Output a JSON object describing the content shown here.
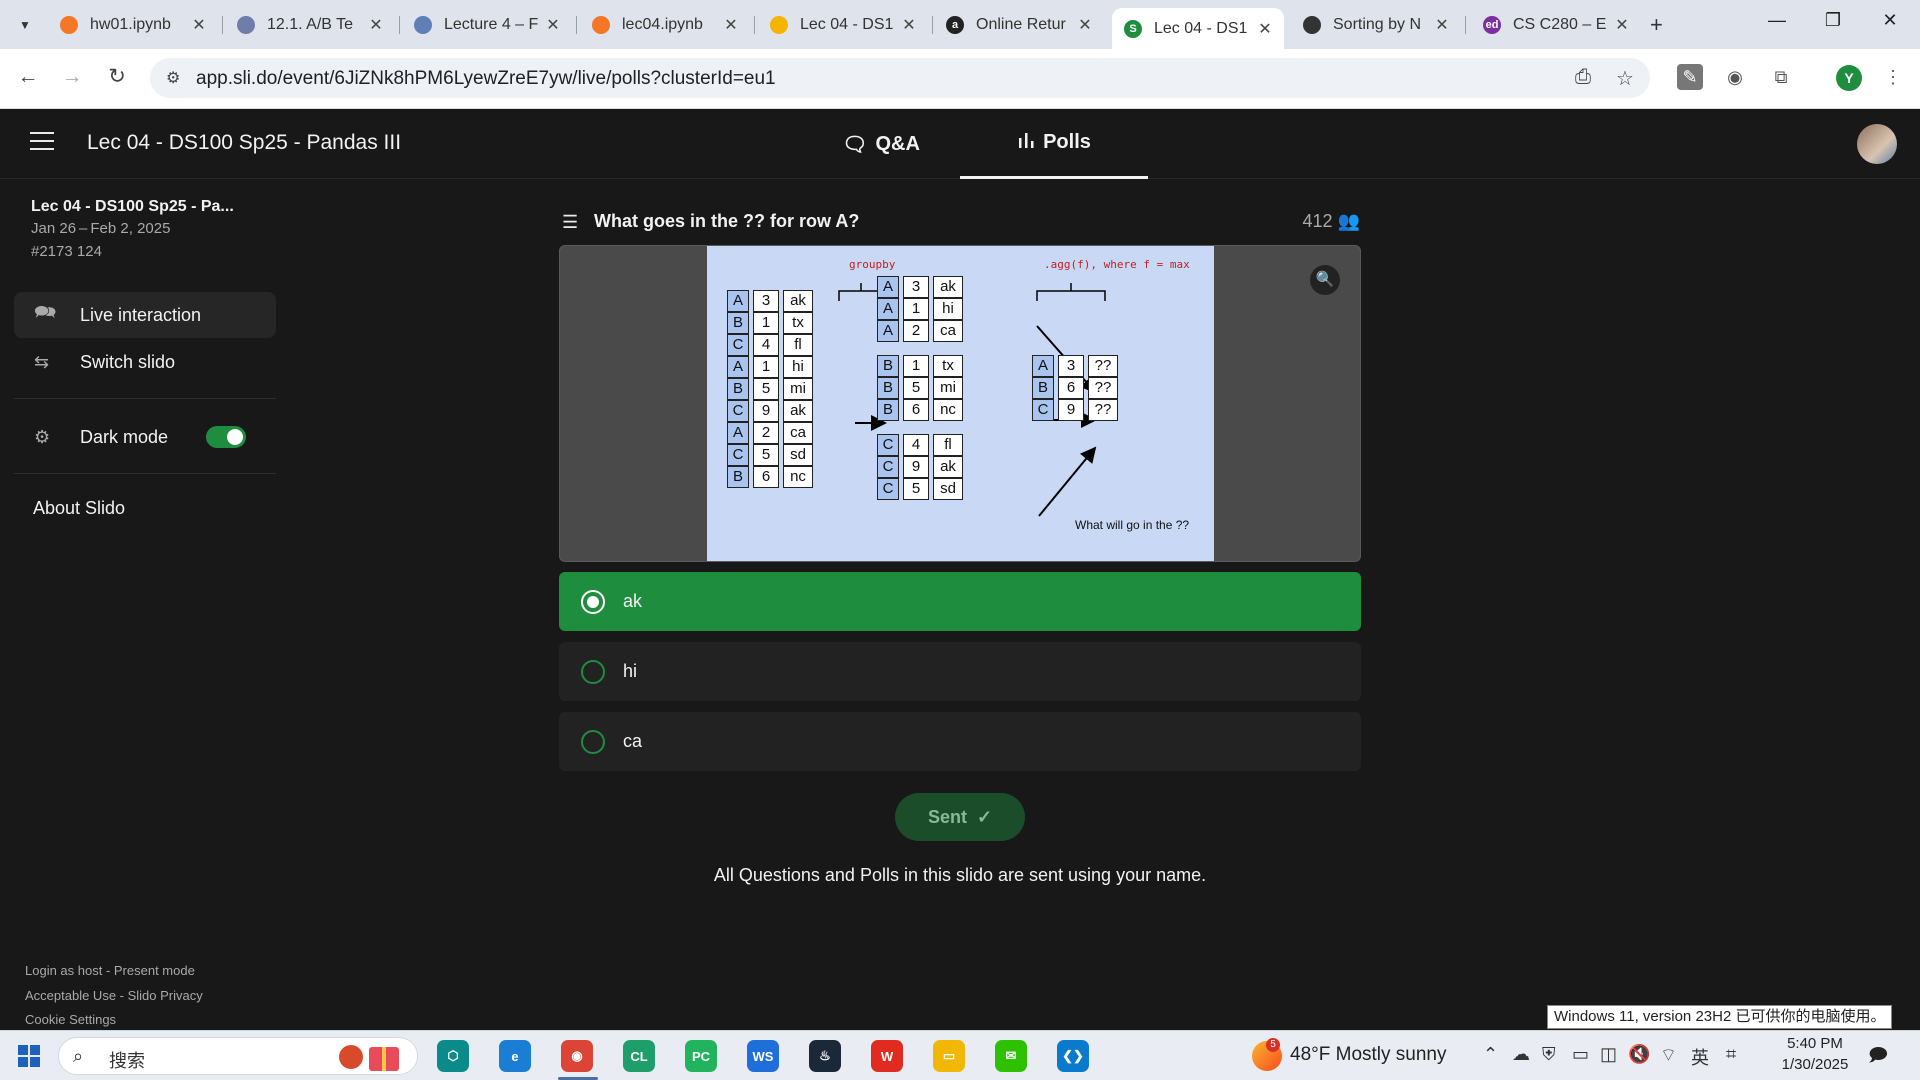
{
  "browser": {
    "tabs": [
      {
        "title": "hw01.ipynb",
        "color": "#f37726",
        "glyph": ""
      },
      {
        "title": "12.1. A/B Te",
        "color": "#6f7dab",
        "glyph": ""
      },
      {
        "title": "Lecture 4 – F",
        "color": "#5f7fb5",
        "glyph": ""
      },
      {
        "title": "lec04.ipynb",
        "color": "#f37726",
        "glyph": ""
      },
      {
        "title": "Lec 04 - DS1",
        "color": "#f4b400",
        "glyph": ""
      },
      {
        "title": "Online Retur",
        "color": "#222222",
        "glyph": "a"
      },
      {
        "title": "Lec 04 - DS1",
        "color": "#1e8e3e",
        "glyph": "S"
      },
      {
        "title": "Sorting by N",
        "color": "#333333",
        "glyph": ""
      },
      {
        "title": "CS C280 – E",
        "color": "#7b2fa0",
        "glyph": "ed"
      }
    ],
    "url": "app.sli.do/event/6JiZNk8hPM6LyewZreE7yw/live/polls?clusterId=eu1",
    "profile_initial": "Y"
  },
  "header": {
    "event_title": "Lec 04 - DS100 Sp25 - Pandas III",
    "tab_qa": "Q&A",
    "tab_polls": "Polls"
  },
  "sidebar": {
    "event_name": "Lec 04 - DS100 Sp25 - Pa...",
    "dates": "Jan 26 – Feb 2, 2025",
    "code": "#2173 124",
    "live_interaction": "Live interaction",
    "switch_slido": "Switch slido",
    "dark_mode": "Dark mode",
    "dark_mode_on": true,
    "about": "About Slido",
    "footer_1": "Login as host - Present mode",
    "footer_2": "Acceptable Use - Slido Privacy",
    "footer_3": "Cookie Settings"
  },
  "poll": {
    "question": "What goes in the ?? for row A?",
    "votes": "412",
    "options": [
      {
        "label": "ak",
        "selected": true
      },
      {
        "label": "hi",
        "selected": false
      },
      {
        "label": "ca",
        "selected": false
      }
    ],
    "sent_label": "Sent",
    "note": "All Questions and Polls in this slido are sent using your name."
  },
  "slide": {
    "groupby_label": "groupby",
    "agg_label": ".agg(f), where f = max",
    "question_note": "What will go in the ??",
    "input_rows": [
      [
        "A",
        "3",
        "ak"
      ],
      [
        "B",
        "1",
        "tx"
      ],
      [
        "C",
        "4",
        "fl"
      ],
      [
        "A",
        "1",
        "hi"
      ],
      [
        "B",
        "5",
        "mi"
      ],
      [
        "C",
        "9",
        "ak"
      ],
      [
        "A",
        "2",
        "ca"
      ],
      [
        "C",
        "5",
        "sd"
      ],
      [
        "B",
        "6",
        "nc"
      ]
    ],
    "group_a": [
      [
        "A",
        "3",
        "ak"
      ],
      [
        "A",
        "1",
        "hi"
      ],
      [
        "A",
        "2",
        "ca"
      ]
    ],
    "group_b": [
      [
        "B",
        "1",
        "tx"
      ],
      [
        "B",
        "5",
        "mi"
      ],
      [
        "B",
        "6",
        "nc"
      ]
    ],
    "group_c": [
      [
        "C",
        "4",
        "fl"
      ],
      [
        "C",
        "9",
        "ak"
      ],
      [
        "C",
        "5",
        "sd"
      ]
    ],
    "result_rows": [
      [
        "A",
        "3",
        "??"
      ],
      [
        "B",
        "6",
        "??"
      ],
      [
        "C",
        "9",
        "??"
      ]
    ]
  },
  "taskbar": {
    "search_placeholder": "搜索",
    "weather_temp": "48°F",
    "weather_desc": "Mostly sunny",
    "weather_badge": "5",
    "ime": "英",
    "time": "5:40 PM",
    "date": "1/30/2025",
    "tooltip": "Windows 11, version 23H2 已可供你的电脑使用。",
    "apps": [
      {
        "name": "app-teal",
        "label": "⬡",
        "color": "#0b8a8a"
      },
      {
        "name": "edge",
        "label": "e",
        "color": "#1a7fd4"
      },
      {
        "name": "chrome",
        "label": "◉",
        "color": "#db4437"
      },
      {
        "name": "clion",
        "label": "CL",
        "color": "#1e9e6a"
      },
      {
        "name": "pycharm",
        "label": "PC",
        "color": "#21b35d"
      },
      {
        "name": "webstorm",
        "label": "WS",
        "color": "#1e6fd9"
      },
      {
        "name": "steam",
        "label": "♨",
        "color": "#1b2838"
      },
      {
        "name": "wps",
        "label": "W",
        "color": "#e02b20"
      },
      {
        "name": "file-explorer",
        "label": "▭",
        "color": "#f2b705"
      },
      {
        "name": "wechat",
        "label": "✉",
        "color": "#2dc100"
      },
      {
        "name": "vscode",
        "label": "❮❯",
        "color": "#0a7acc"
      }
    ]
  }
}
